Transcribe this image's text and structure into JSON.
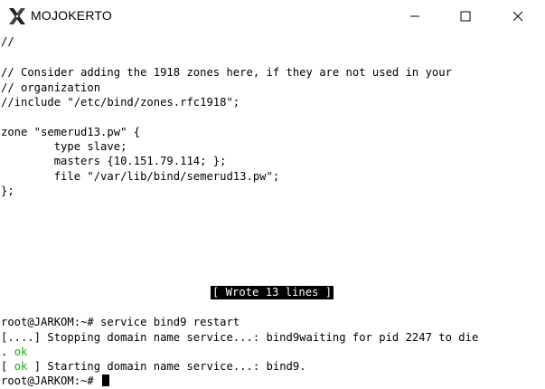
{
  "window": {
    "title": "MOJOKERTO",
    "icon": "x-server-icon",
    "controls": [
      "minimize-icon",
      "maximize-icon",
      "close-icon"
    ]
  },
  "editor": {
    "lines": [
      "//",
      "",
      "// Consider adding the 1918 zones here, if they are not used in your",
      "// organization",
      "//include \"/etc/bind/zones.rfc1918\";",
      "",
      "zone \"semerud13.pw\" {",
      "        type slave;",
      "        masters {10.151.79.114; };",
      "        file \"/var/lib/bind/semerud13.pw\";",
      "};"
    ],
    "status_message": "[ Wrote 13 lines ]"
  },
  "shell": {
    "command_line": "root@JARKOM:~# service bind9 restart",
    "stop_prefix": "[....] Stopping domain name service...: bind9waiting for pid 2247 to die",
    "stop_result_prefix": ". ",
    "stop_result": "ok",
    "start_open": "[ ",
    "start_ok": "ok",
    "start_text": " ] Starting domain name service...: bind9.",
    "prompt": "root@JARKOM:~# "
  },
  "colors": {
    "ok": "#12b312",
    "background": "#ffffff",
    "foreground": "#000000"
  }
}
